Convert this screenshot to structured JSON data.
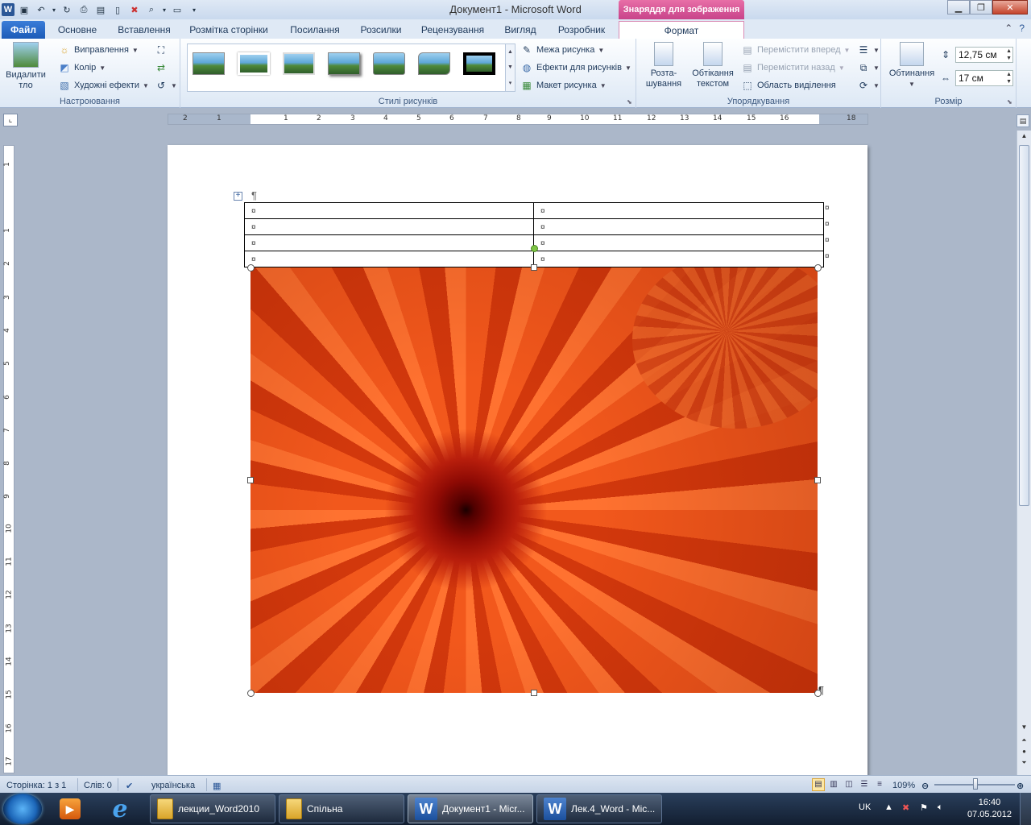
{
  "window": {
    "title": "Документ1 - Microsoft Word",
    "picture_tools_header": "Знаряддя для зображення"
  },
  "tabs": [
    {
      "label": "Файл"
    },
    {
      "label": "Основне"
    },
    {
      "label": "Вставлення"
    },
    {
      "label": "Розмітка сторінки"
    },
    {
      "label": "Посилання"
    },
    {
      "label": "Розсилки"
    },
    {
      "label": "Рецензування"
    },
    {
      "label": "Вигляд"
    },
    {
      "label": "Розробник"
    },
    {
      "label": "Формат"
    }
  ],
  "ribbon": {
    "adjust": {
      "remove_bg": "Видалити тло",
      "corrections": "Виправлення",
      "color": "Колір",
      "artistic": "Художні ефекти",
      "group_label": "Настроювання"
    },
    "styles": {
      "border": "Межа рисунка",
      "effects": "Ефекти для рисунків",
      "layout": "Макет рисунка",
      "group_label": "Стилі рисунків"
    },
    "arrange": {
      "position": "Розта-шування",
      "wrap": "Обтікання текстом",
      "bring_forward": "Перемістити вперед",
      "send_backward": "Перемістити назад",
      "selection_pane": "Область виділення",
      "group_label": "Упорядкування"
    },
    "size": {
      "crop": "Обтинання",
      "height": "12,75 см",
      "width": "17 см",
      "group_label": "Розмір"
    }
  },
  "ruler_h": [
    "2",
    "1",
    "1",
    "2",
    "3",
    "4",
    "5",
    "6",
    "7",
    "8",
    "9",
    "10",
    "11",
    "12",
    "13",
    "14",
    "15",
    "16",
    "18"
  ],
  "ruler_v": [
    "1",
    "1",
    "2",
    "3",
    "4",
    "5",
    "6",
    "7",
    "8",
    "9",
    "10",
    "11",
    "12",
    "13",
    "14",
    "15",
    "16",
    "17"
  ],
  "document": {
    "pilcrow": "¶",
    "cell_mark": "¤",
    "rows": [
      [
        "¤",
        "¤"
      ],
      [
        "¤",
        "¤"
      ],
      [
        "¤",
        "¤"
      ],
      [
        "¤",
        "¤"
      ]
    ]
  },
  "statusbar": {
    "page": "Сторінка: 1 з 1",
    "words": "Слів: 0",
    "language": "українська",
    "zoom": "109%",
    "zoom_level_percent": 109
  },
  "taskbar": {
    "tasks": [
      {
        "label": "лекции_Word2010"
      },
      {
        "label": "Спільна"
      },
      {
        "label": "Документ1 - Micr..."
      },
      {
        "label": "Лек.4_Word - Mic..."
      }
    ],
    "lang": "UK",
    "time": "16:40",
    "date": "07.05.2012"
  }
}
